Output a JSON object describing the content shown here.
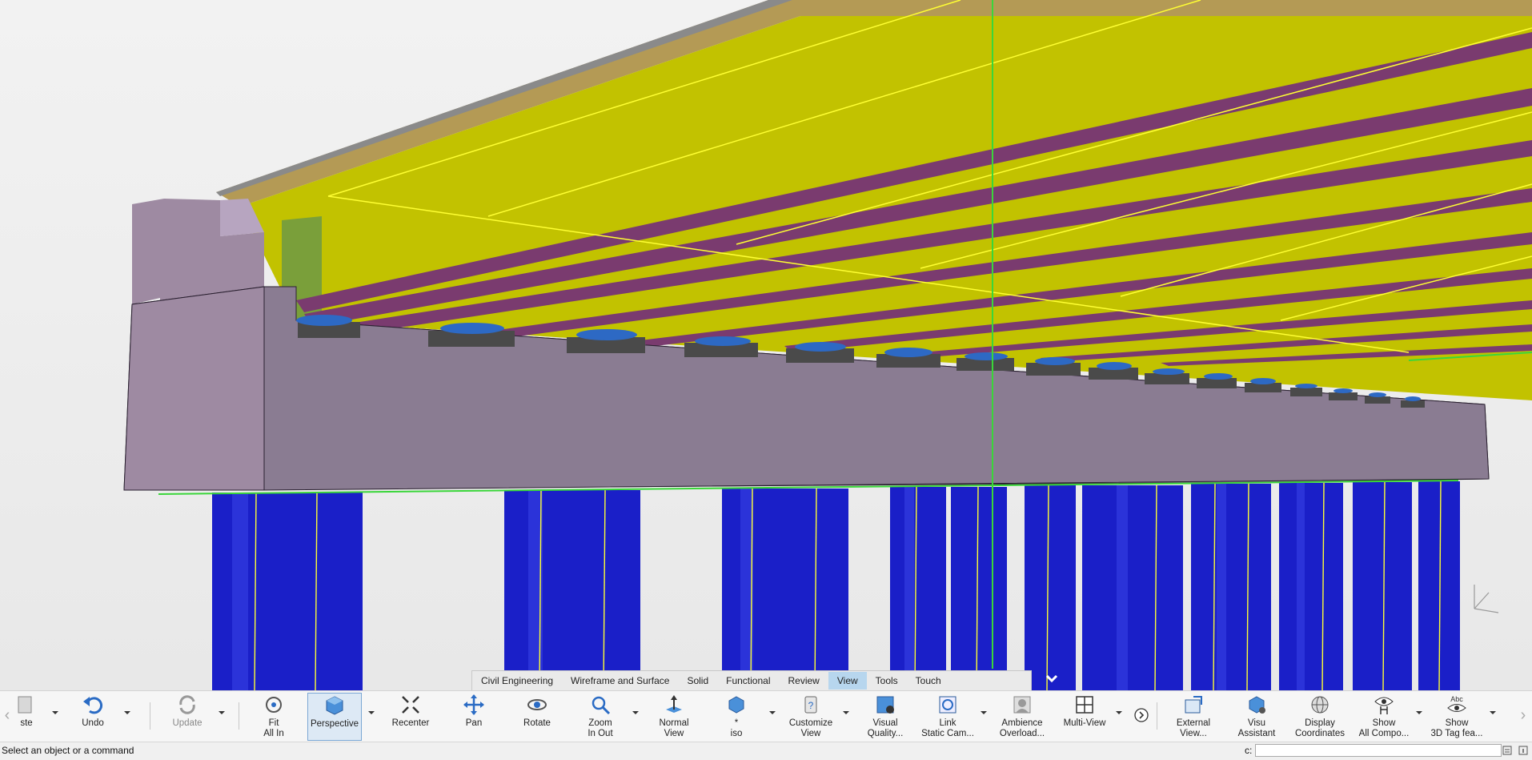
{
  "viewport": {
    "colors": {
      "background": "#efefef",
      "deck_top": "#b49a55",
      "girder": "#c2c200",
      "flange": "#7a3b6f",
      "pier_cap": "#8e7e96",
      "bearing": "#2d69c4",
      "column": "#1a1fc8",
      "highlight": "#3ad63a"
    }
  },
  "workbench_tabs": [
    {
      "label": "Civil Engineering",
      "active": false
    },
    {
      "label": "Wireframe and Surface",
      "active": false
    },
    {
      "label": "Solid",
      "active": false
    },
    {
      "label": "Functional",
      "active": false
    },
    {
      "label": "Review",
      "active": false
    },
    {
      "label": "View",
      "active": true
    },
    {
      "label": "Tools",
      "active": false
    },
    {
      "label": "Touch",
      "active": false
    }
  ],
  "toolbar": {
    "paste": "ste",
    "undo": "Undo",
    "update": "Update",
    "fit_all_in": [
      "Fit",
      "All In"
    ],
    "perspective": "Perspective",
    "recenter": "Recenter",
    "pan": "Pan",
    "rotate": "Rotate",
    "zoom": [
      "Zoom",
      "In Out"
    ],
    "normal_view": [
      "Normal",
      "View"
    ],
    "iso": [
      "*",
      "iso"
    ],
    "customize_view": [
      "Customize",
      "View"
    ],
    "visual_quality": [
      "Visual",
      "Quality..."
    ],
    "link_static_cam": [
      "Link",
      "Static Cam..."
    ],
    "ambience": [
      "Ambience",
      "Overload..."
    ],
    "multi_view": "Multi-View",
    "external_view": [
      "External",
      "View..."
    ],
    "visu_assistant": [
      "Visu",
      "Assistant"
    ],
    "display_coordinates": [
      "Display",
      "Coordinates"
    ],
    "show_all_components": [
      "Show",
      "All Compo..."
    ],
    "show_3d_tag": [
      "Show",
      "3D Tag fea..."
    ]
  },
  "status": {
    "message": "Select an object or a command",
    "command_label": "c:",
    "command_value": ""
  }
}
